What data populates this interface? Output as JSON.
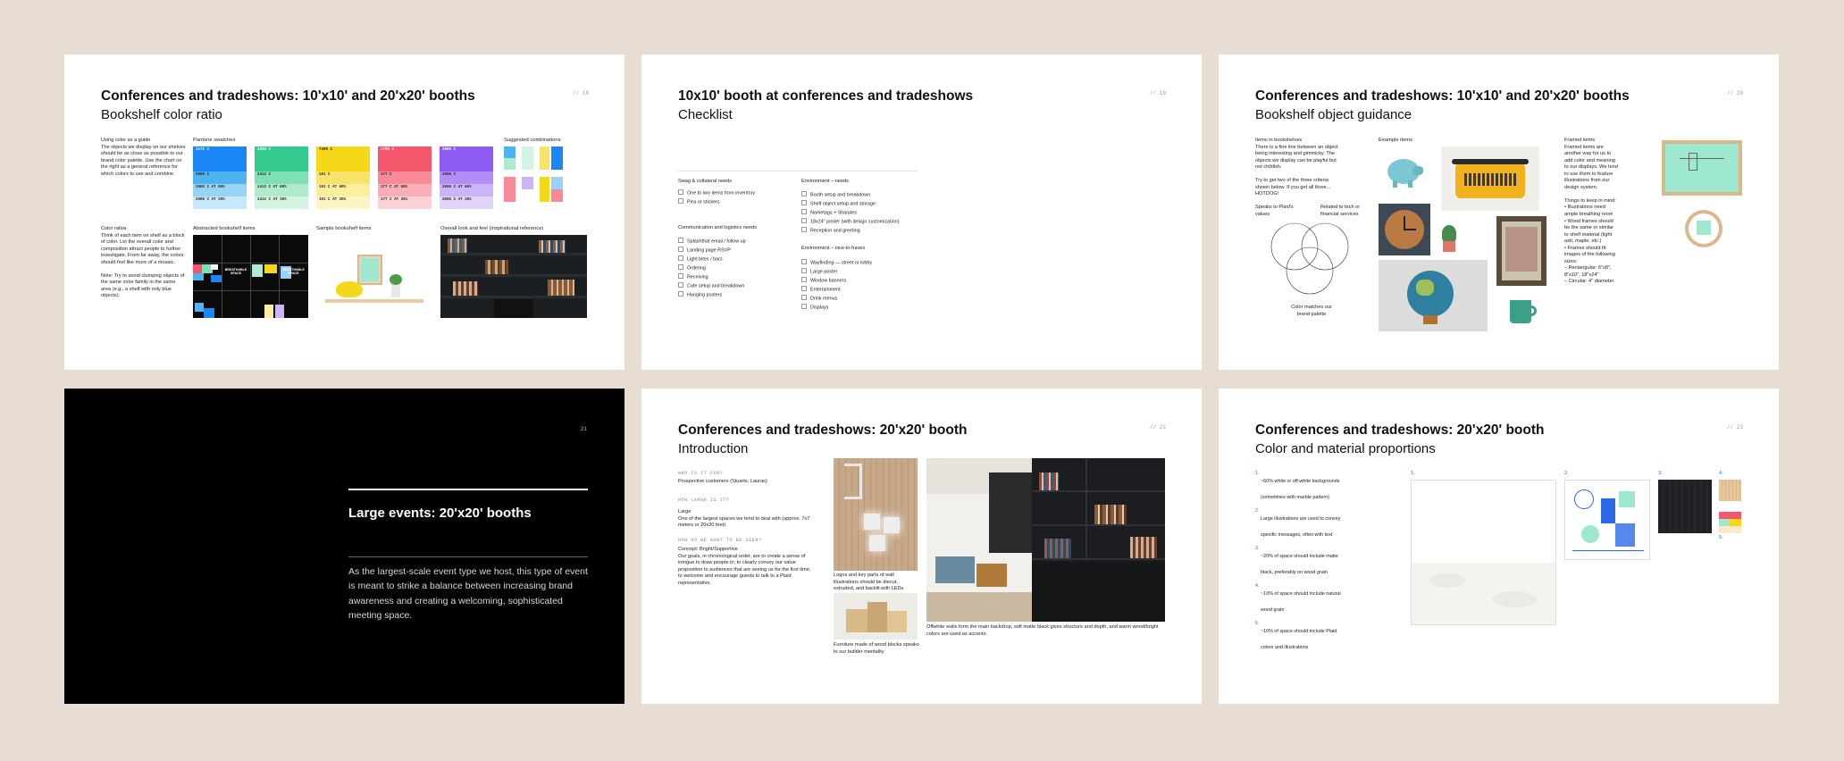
{
  "slides": [
    {
      "page": "// 18",
      "title": "Conferences and tradeshows: 10'x10' and 20'x20' booths",
      "subtitle": "Bookshelf color ratio",
      "intro": "Using color as a guide\nThe objects we display on our shelves should be as close as possible to our brand color palette. Use the chart on the right as a general reference for which colors to use and combine.",
      "ratios": "Color ratios\nThink of each item on shelf as a block of color. Let the overall color and composition attract people to further investigate. From far away, the colors should feel like more of a mosaic.\n\nNote: Try to avoid clumping objects of the same color family in the same area (e.g., a shelf with only blue objects).",
      "pantone_label": "Pantone swatches",
      "combos_label": "Suggested combinations",
      "abstract_label": "Abstracted bookshelf items",
      "sample_label": "Sample bookshelf items",
      "overall_label": "Overall look and feel (inspirational reference)",
      "breathable": "BREATHABLE SPACE",
      "swatches": [
        {
          "rows": [
            "2172 C",
            "2985 C",
            "2985 C AT 60%",
            "2985 C AT 30%"
          ],
          "colors": [
            "#1b86f5",
            "#4fb3f2",
            "#98d3f6",
            "#c7e8fb"
          ]
        },
        {
          "rows": [
            "3395 C",
            "2412 C",
            "2412 C AT 60%",
            "2412 C AT 35%"
          ],
          "colors": [
            "#34c98f",
            "#7fdfb6",
            "#aeeacb",
            "#d3f4e2"
          ]
        },
        {
          "rows": [
            "7405 C",
            "101 C",
            "101 C AT 60%",
            "101 C AT 35%"
          ],
          "colors": [
            "#f6d81a",
            "#f8e46a",
            "#fbee9c",
            "#fdf4c6"
          ]
        },
        {
          "rows": [
            "1785 C",
            "177 C",
            "177 C AT 60%",
            "177 C AT 35%"
          ],
          "colors": [
            "#f4566b",
            "#f88a97",
            "#faafb8",
            "#fcd2d7"
          ]
        },
        {
          "rows": [
            "2665 C",
            "2655 C",
            "2655 C AT 60%",
            "2655 C AT 35%"
          ],
          "colors": [
            "#8d5cf3",
            "#b28ff6",
            "#ccb4f8",
            "#e1d5fb"
          ]
        }
      ],
      "combo_colors": [
        "#4fb3f2",
        "#aeeacb",
        "#98d3f6",
        "#f8e46a",
        "#1b86f5",
        "#f88a97",
        "#ccb4f8",
        "#4fb3f2",
        "#f6d81a",
        "#98d3f6"
      ]
    },
    {
      "page": "// 19",
      "title": "10x10' booth at conferences and tradeshows",
      "subtitle": "Checklist",
      "col1_head": "Swag & collateral needs",
      "col1": [
        "One to two items from inventory",
        "Pins or stickers"
      ],
      "col1b_head": "Communication and logistics needs",
      "col1b": [
        "Splashthat email / follow up",
        "Landing page RSVP",
        "Light bites / bars",
        "Ordering",
        "Receiving",
        "Cafe setup and breakdown",
        "Hanging posters"
      ],
      "col2_head": "Environment – needs",
      "col2": [
        "Booth setup and breakdown",
        "Shelf object setup and storage",
        "Nametags + Sharpies",
        "18x24\" poster (with design customization)",
        "Reception and greeting"
      ],
      "col2b_head": "Environment – nice-to-haves",
      "col2b": [
        "Wayfinding — street or lobby",
        "Large poster",
        "Window banners",
        "Entertainment",
        "Drink menus",
        "Displays"
      ]
    },
    {
      "page": "// 20",
      "title": "Conferences and tradeshows: 10'x10' and 20'x20' booths",
      "subtitle": "Bookshelf object guidance",
      "items": "Items in bookshelves\nThere is a fine line between an object being interesting and gimmicky. The objects we display can be playful but not childish.\n\nTry to get two of the three criteria shown below. If you get all three... HOTDOG!",
      "venn1": "Speaks to Plaid's values",
      "venn2": "Related to tech or financial services",
      "venn3": "Color matches our brand palette",
      "examples_label": "Example items",
      "framed": "Framed items\nFramed items are another way for us to add color and meaning to our displays. We tend to use them to feature illustrations from our design system.\n\nThings to keep in mind:\n•  Illustrations need ample breathing room\n•  Wood frames should be the same or similar to shelf material (light ash, maple, etc.)\n•  Frames should fit images of the following sizes:\n     – Rectangular: 6\"x8\", 8\"x10\", 18\"x24\"\n     – Circular: 4\" diameter"
    },
    {
      "page": "21",
      "title": "Large events: 20'x20' booths",
      "body": "As the largest-scale event type we host, this type of event is meant to strike a balance between increasing brand awareness and creating a welcoming, sophisticated meeting space."
    },
    {
      "page": "// 22",
      "title": "Conferences and tradeshows: 20'x20' booth",
      "subtitle": "Introduction",
      "q1": "WHO IS IT FOR?",
      "a1": "Prospective customers (Stuarts, Lauras)",
      "q2": "HOW LARGE IS IT?",
      "a2": "Large\nOne of the largest spaces we tend to deal with (approx. 7x7 meters or 20x20 feet)",
      "q3": "HOW DO WE WANT TO BE SEEN?",
      "a3": "Concept: Bright/Supportive\nOur goals, in chronological order, are to create a sense of intrigue to draw people in; to clearly convey our value proposition to audiences that are seeing us for the first time; to welcome and encourage guests to talk to a Plaid representative.",
      "cap_logo": "Logos and key parts of wall illustrations should be diecut, extruded, and backlit with LEDs",
      "cap_blocks": "Furniture made of wood blocks speaks to our builder mentality",
      "cap_walls": "Offwhite walls form the main backdrop, soft matte black gives structure and depth, and warm wood/bright colors are used as accents."
    },
    {
      "page": "// 23",
      "title": "Conferences and tradeshows: 20'x20' booth",
      "subtitle": "Color and material proportions",
      "list": [
        {
          "n": "1.",
          "text": "~60% white or off-white backgrounds (sometimes with marble pattern)"
        },
        {
          "n": "2.",
          "text": "Large illustrations are used to convey specific messages, often with text"
        },
        {
          "n": "3.",
          "text": "~20% of space should include matte black, preferably on wood grain"
        },
        {
          "n": "4.",
          "text": "~10% of space should include natural wood grain"
        },
        {
          "n": "5.",
          "text": "~10% of space should include Plaid colors and illustrations"
        }
      ],
      "labels": [
        "1.",
        "2.",
        "3.",
        "4.",
        "5."
      ]
    }
  ]
}
